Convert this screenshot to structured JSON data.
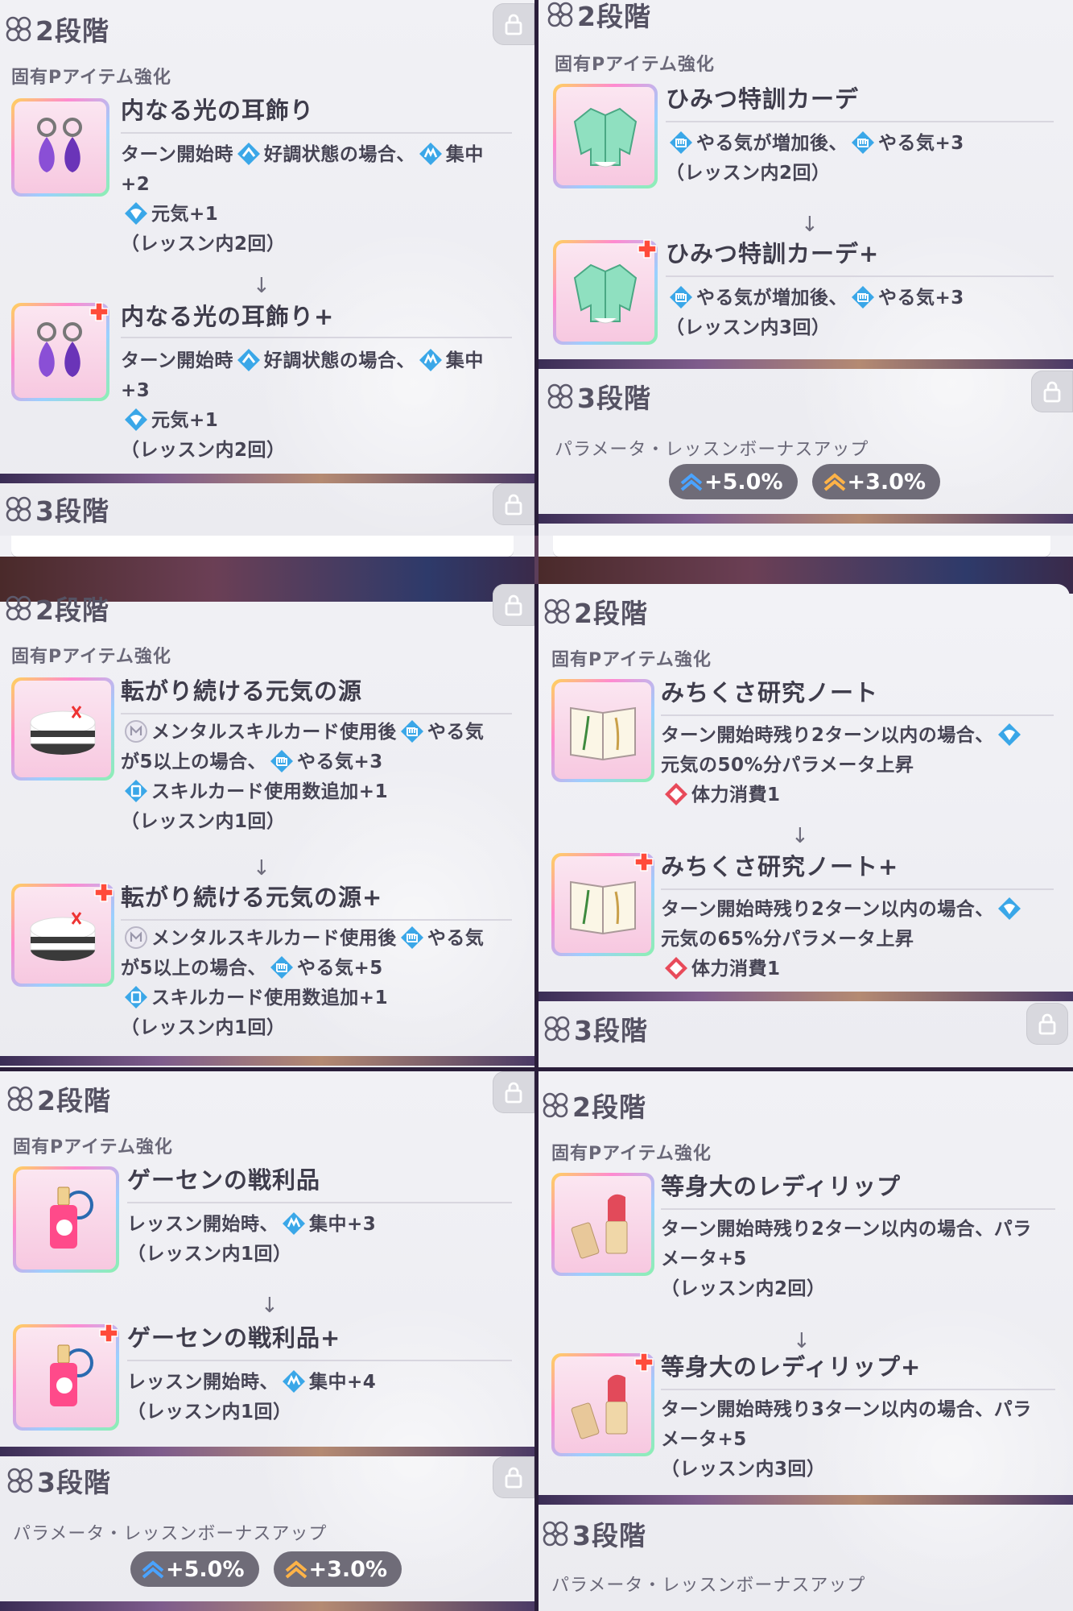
{
  "stage2": "2段階",
  "stage3": "3段階",
  "section": "固有Pアイテム強化",
  "bonus_label": "パラメータ・レッスンボーナスアップ",
  "bonus_blue": "+5.0%",
  "bonus_orange": "+3.0%",
  "p1": {
    "a_name": "内なる光の耳飾り",
    "a_l1a": "ターン開始時",
    "a_l1b": "好調状態の場合、",
    "a_l1c": "集中",
    "a_l2": "+2",
    "a_l3": "元気+1",
    "a_l4": "（レッスン内2回）",
    "b_name": "内なる光の耳飾り+",
    "b_l1a": "ターン開始時",
    "b_l1b": "好調状態の場合、",
    "b_l1c": "集中",
    "b_l2": "+3",
    "b_l3": "元気+1",
    "b_l4": "（レッスン内2回）"
  },
  "p2": {
    "a_name": "ひみつ特訓カーデ",
    "a_l1a": "やる気が増加後、",
    "a_l1b": "やる気+3",
    "a_l2": "（レッスン内2回）",
    "b_name": "ひみつ特訓カーデ+",
    "b_l1a": "やる気が増加後、",
    "b_l1b": "やる気+3",
    "b_l2": "（レッスン内3回）"
  },
  "p3": {
    "a_name": "転がり続ける元気の源",
    "a_l1a": "メンタルスキルカード使用後",
    "a_l1b": "やる気",
    "a_l2a": "が5以上の場合、",
    "a_l2b": "やる気+3",
    "a_l3": "スキルカード使用数追加+1",
    "a_l4": "（レッスン内1回）",
    "b_name": "転がり続ける元気の源+",
    "b_l1a": "メンタルスキルカード使用後",
    "b_l1b": "やる気",
    "b_l2a": "が5以上の場合、",
    "b_l2b": "やる気+5",
    "b_l3": "スキルカード使用数追加+1",
    "b_l4": "（レッスン内1回）"
  },
  "p4": {
    "a_name": "みちくさ研究ノート",
    "a_l1": "ターン開始時残り2ターン以内の場合、",
    "a_l2": "元気の50%分パラメータ上昇",
    "a_l3": "体力消費1",
    "b_name": "みちくさ研究ノート+",
    "b_l1": "ターン開始時残り2ターン以内の場合、",
    "b_l2": "元気の65%分パラメータ上昇",
    "b_l3": "体力消費1"
  },
  "p5": {
    "a_name": "ゲーセンの戦利品",
    "a_l1a": "レッスン開始時、",
    "a_l1b": "集中+3",
    "a_l2": "（レッスン内1回）",
    "b_name": "ゲーセンの戦利品+",
    "b_l1a": "レッスン開始時、",
    "b_l1b": "集中+4",
    "b_l2": "（レッスン内1回）"
  },
  "p6": {
    "a_name": "等身大のレディリップ",
    "a_l1": "ターン開始時残り2ターン以内の場合、パラ",
    "a_l2": "メータ+5",
    "a_l3": "（レッスン内2回）",
    "b_name": "等身大のレディリップ+",
    "b_l1": "ターン開始時残り3ターン以内の場合、パラ",
    "b_l2": "メータ+5",
    "b_l3": "（レッスン内3回）"
  }
}
